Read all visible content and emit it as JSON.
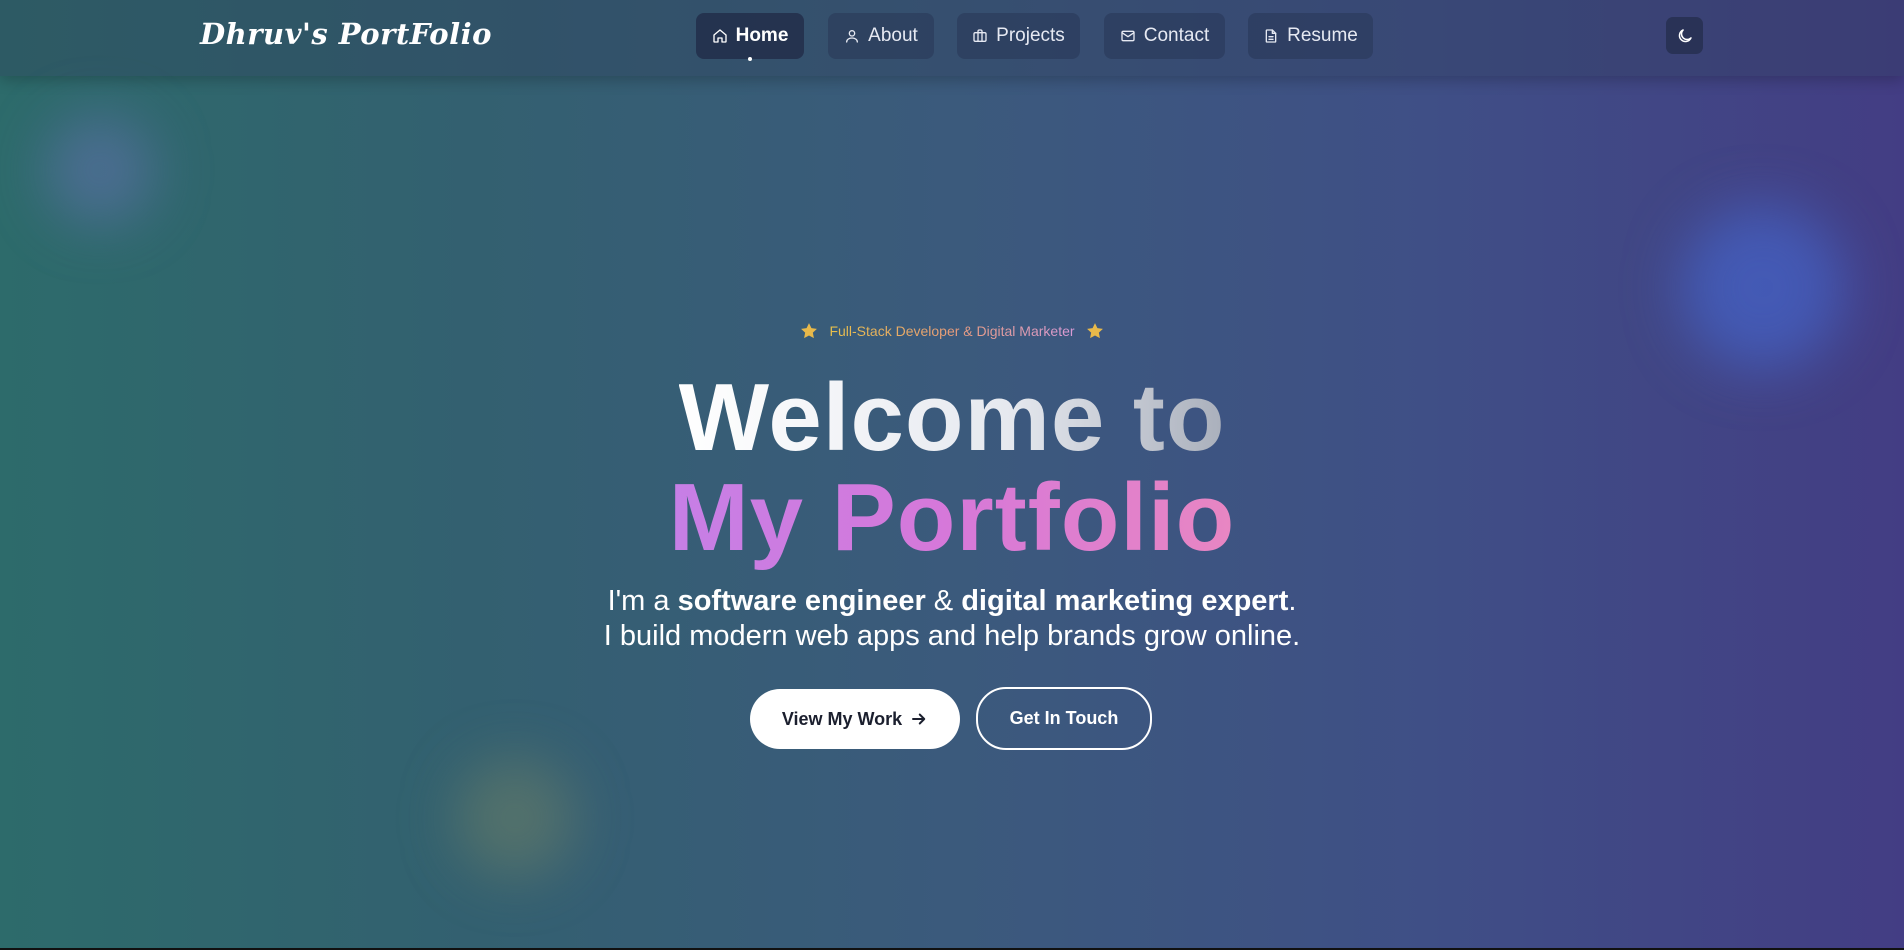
{
  "brand": {
    "logo_text": "Dhruv's PortFolio"
  },
  "nav": {
    "items": [
      {
        "label": "Home",
        "icon": "home-icon",
        "active": true
      },
      {
        "label": "About",
        "icon": "user-icon",
        "active": false
      },
      {
        "label": "Projects",
        "icon": "briefcase-icon",
        "active": false
      },
      {
        "label": "Contact",
        "icon": "mail-icon",
        "active": false
      },
      {
        "label": "Resume",
        "icon": "document-icon",
        "active": false
      }
    ],
    "theme_toggle_icon": "moon-icon"
  },
  "hero": {
    "tagline": "Full-Stack Developer & Digital Marketer",
    "headline_line1": "Welcome to",
    "headline_line2": "My Portfolio",
    "intro": {
      "prefix": "I'm a ",
      "role1": "software engineer",
      "joiner": " & ",
      "role2": "digital marketing expert",
      "suffix": "."
    },
    "subline": "I build modern web apps and help brands grow online.",
    "primary_cta": "View My Work",
    "secondary_cta": "Get In Touch"
  },
  "colors": {
    "bg_left": "#2d6b6b",
    "bg_right": "#433d84",
    "accent_pink": "#d678d9",
    "star_gold": "#e8b94a"
  }
}
